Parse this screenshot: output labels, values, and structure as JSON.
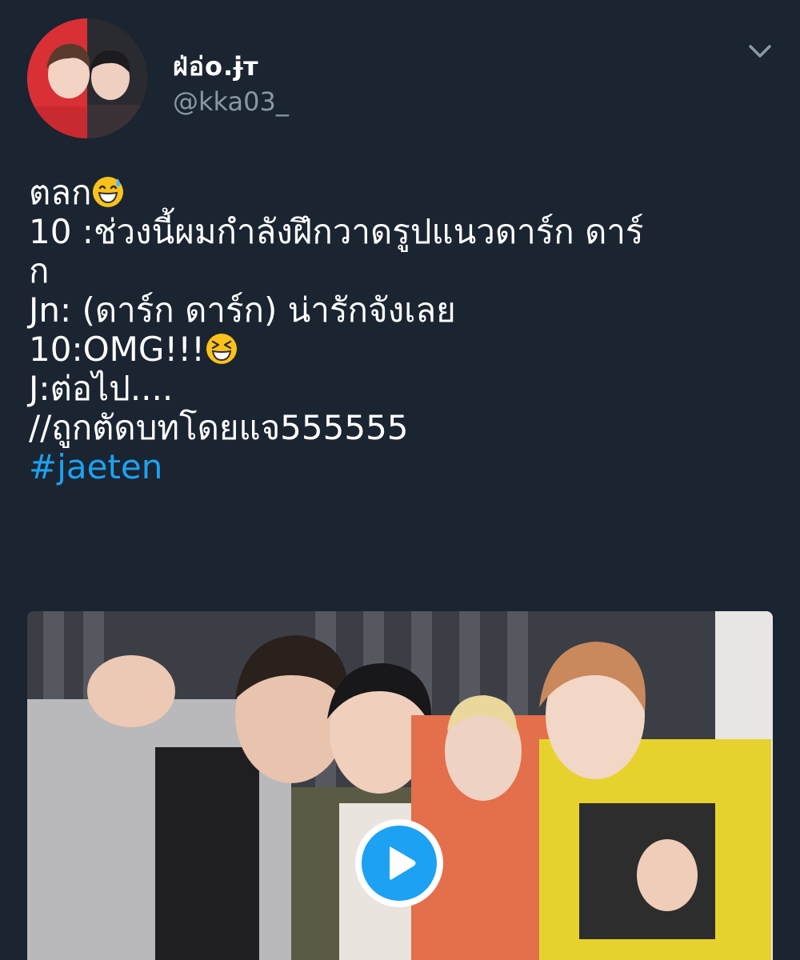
{
  "user": {
    "display_name": "ฝ่อ่o.ɉт",
    "handle": "@kka03_",
    "avatar_icon": "profile-photo"
  },
  "menu": {
    "icon": "chevron-down-icon"
  },
  "tweet": {
    "lines": [
      "ตลก",
      "10 :ช่วงนี้ผมกำลังฝึกวาดรูปแนวดาร์ก ดาร์",
      "ก",
      "Jn: (ดาร์ก ดาร์ก) น่ารักจังเลย",
      "10:OMG!!!",
      "J:ต่อไป....",
      "//ถูกตัดบทโดยแจ555555"
    ],
    "hashtag": "#jaeten",
    "emoji_1": "grinning-sweat-emoji",
    "emoji_2": "laughing-squinting-emoji"
  },
  "media": {
    "type": "video",
    "play_icon": "play-icon"
  },
  "colors": {
    "background": "#1b2431",
    "text": "#ffffff",
    "secondary": "#8899a6",
    "accent": "#1da1f2"
  }
}
